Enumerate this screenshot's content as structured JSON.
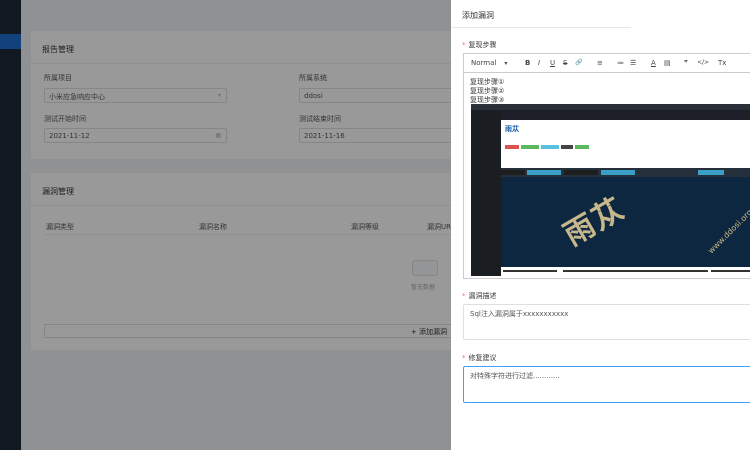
{
  "background": {
    "report_card": {
      "title": "报告管理",
      "project_label": "所属项目",
      "project_value": "小米应急响应中心",
      "system_label": "所属系统",
      "system_value": "ddosi",
      "start_time_label": "测试开始时间",
      "start_time_value": "2021-11-12",
      "end_time_label": "测试结束时间",
      "end_time_value": "2021-11-16"
    },
    "vuln_card": {
      "title": "漏洞管理",
      "columns": [
        "漏洞类型",
        "漏洞名称",
        "漏洞等级",
        "漏洞URL"
      ],
      "empty_text": "暂无数据",
      "add_button": "+ 添加漏洞"
    }
  },
  "drawer": {
    "title": "添加漏洞",
    "steps_label": "复现步骤",
    "required_mark": "*",
    "toolbar": {
      "format": "Normal",
      "bold": "B",
      "italic": "I",
      "underline": "U",
      "strike": "S",
      "link": "🔗",
      "align": "≡",
      "ordered": "≔",
      "bullet": "☰",
      "color": "A",
      "background": "▤",
      "quote": "❞",
      "code": "</>",
      "clean": "Tx"
    },
    "steps_lines": [
      "复现步骤①",
      "复现步骤②",
      "复现步骤③"
    ],
    "screenshot": {
      "logo_text": "雨苁",
      "stamp_text": "雨苁",
      "watermark": "www.ddosi.org"
    },
    "desc_label": "漏洞描述",
    "desc_value": "Sql注入漏洞属于xxxxxxxxxxx",
    "fix_label": "修复建议",
    "fix_value": "对特殊字符进行过滤............"
  },
  "colors": {
    "sidebar": "#1b2a39",
    "accent": "#1e6fcf",
    "focus_border": "#409eff",
    "required": "#f56c6c"
  }
}
